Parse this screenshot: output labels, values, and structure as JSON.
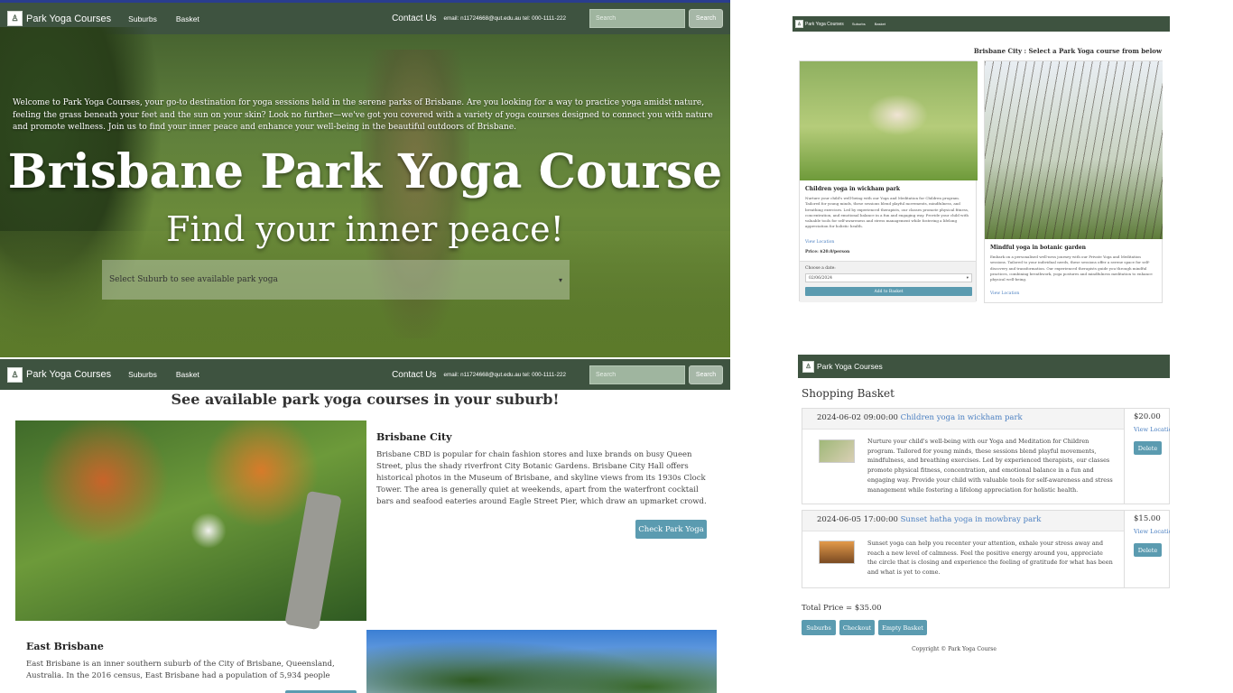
{
  "brand": {
    "name": "Park Yoga Courses"
  },
  "nav": {
    "suburbs": "Suburbs",
    "basket": "Basket",
    "contact": "Contact Us",
    "contact_details": "email: n11724668@qut.edu.au tel: 000-1111-222"
  },
  "search": {
    "placeholder": "Search",
    "button": "Search"
  },
  "hero": {
    "intro": "Welcome to Park Yoga Courses, your go-to destination for yoga sessions held in the serene parks of Brisbane. Are you looking for a way to practice yoga amidst nature, feeling the grass beneath your feet and the sun on your skin? Look no further—we've got you covered with a variety of yoga courses designed to connect you with nature and promote wellness. Join us to find your inner peace and enhance your well-being in the beautiful outdoors of Brisbane.",
    "title": "Brisbane Park Yoga Course",
    "subtitle": "Find your inner peace!",
    "select_placeholder": "Select Suburb to see available park yoga",
    "caret": "▾"
  },
  "suburbs_page": {
    "heading": "See available park yoga courses in your suburb!",
    "suburbs": [
      {
        "name": "Brisbane City",
        "description": "Brisbane CBD is popular for chain fashion stores and luxe brands on busy Queen Street, plus the shady riverfront City Botanic Gardens. Brisbane City Hall offers historical photos in the Museum of Brisbane, and skyline views from its 1930s Clock Tower. The area is generally quiet at weekends, apart from the waterfront cocktail bars and seafood eateries around Eagle Street Pier, which draw an upmarket crowd.",
        "button": "Check Park Yoga"
      },
      {
        "name": "East Brisbane",
        "description": "East Brisbane is an inner southern suburb of the City of Brisbane, Queensland, Australia. In the 2016 census, East Brisbane had a population of 5,934 people"
      }
    ]
  },
  "courses_page": {
    "heading": "Brisbane City : Select a Park Yoga course from below",
    "courses": [
      {
        "title": "Children yoga in wickham park",
        "description": "Nurture your child's well-being with our Yoga and Meditation for Children program. Tailored for young minds, these sessions blend playful movements, mindfulness, and breathing exercises. Led by experienced therapists, our classes promote physical fitness, concentration, and emotional balance in a fun and engaging way. Provide your child with valuable tools for self-awareness and stress management while fostering a lifelong appreciation for holistic health.",
        "location_link": "View Location",
        "price": "Price: $20.0/person",
        "date_label": "Choose a date:",
        "date_value": "02/06/2024",
        "date_caret": "▾",
        "add_button": "Add to Basket"
      },
      {
        "title": "Mindful yoga in botanic garden",
        "description": "Embark on a personalised well-ness journey with our Private Yoga and Meditation sessions. Tailored to your individual needs, these sessions offer a serene space for self-discovery and transformation. Our experienced therapists guide you through mindful practices, combining breathwork, yoga postures and mindfulness meditation to enhance physical well-being.",
        "location_link": "View Location"
      }
    ]
  },
  "basket_page": {
    "heading": "Shopping Basket",
    "items": [
      {
        "datetime": "2024-06-02 09:00:00",
        "title": "Children yoga in wickham park",
        "description": "Nurture your child's well-being with our Yoga and Meditation for Children program. Tailored for young minds, these sessions blend playful movements, mindfulness, and breathing exercises. Led by experienced therapists, our classes promote physical fitness, concentration, and emotional balance in a fun and engaging way. Provide your child with valuable tools for self-awareness and stress management while fostering a lifelong appreciation for holistic health.",
        "price": "$20.00",
        "location_link": "View Location",
        "delete": "Delete"
      },
      {
        "datetime": "2024-06-05 17:00:00",
        "title": "Sunset hatha yoga in mowbray park",
        "description": "Sunset yoga can help you recenter your attention, exhale your stress away and reach a new level of calmness. Feel the positive energy around you, appreciate the circle that is closing and experience the feeling of gratitude for what has been and what is yet to come.",
        "price": "$15.00",
        "location_link": "View Location",
        "delete": "Delete"
      }
    ],
    "total": "Total Price = $35.00",
    "buttons": {
      "suburbs": "Suburbs",
      "checkout": "Checkout",
      "empty": "Empty Basket"
    },
    "copyright": "Copyright © Park Yoga Course"
  },
  "colors": {
    "nav": "#3e5340",
    "accent": "#5b9bb0",
    "link": "#4a7fc1"
  },
  "icons": {
    "logo": "yoga-logo-icon"
  }
}
